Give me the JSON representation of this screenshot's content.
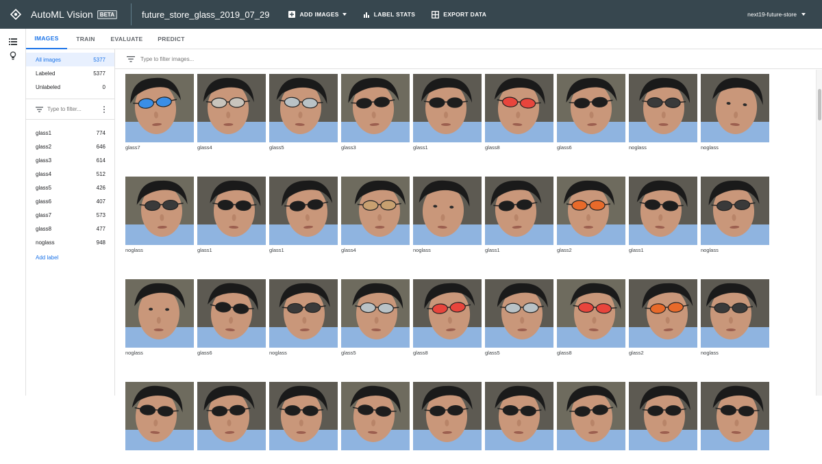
{
  "app": {
    "title": "AutoML Vision",
    "badge": "BETA"
  },
  "dataset": {
    "name": "future_store_glass_2019_07_29"
  },
  "toolbar": {
    "add_images": "ADD IMAGES",
    "label_stats": "LABEL STATS",
    "export_data": "EXPORT DATA"
  },
  "project": {
    "name": "next19-future-store"
  },
  "tabs": [
    {
      "label": "IMAGES",
      "active": true
    },
    {
      "label": "TRAIN",
      "active": false
    },
    {
      "label": "EVALUATE",
      "active": false
    },
    {
      "label": "PREDICT",
      "active": false
    }
  ],
  "summary": [
    {
      "label": "All images",
      "count": "5377",
      "active": true
    },
    {
      "label": "Labeled",
      "count": "5377",
      "active": false
    },
    {
      "label": "Unlabeled",
      "count": "0",
      "active": false
    }
  ],
  "label_filter": {
    "placeholder": "Type to filter..."
  },
  "labels": [
    {
      "label": "glass1",
      "count": "774"
    },
    {
      "label": "glass2",
      "count": "646"
    },
    {
      "label": "glass3",
      "count": "614"
    },
    {
      "label": "glass4",
      "count": "512"
    },
    {
      "label": "glass5",
      "count": "426"
    },
    {
      "label": "glass6",
      "count": "407"
    },
    {
      "label": "glass7",
      "count": "573"
    },
    {
      "label": "glass8",
      "count": "477"
    },
    {
      "label": "noglass",
      "count": "948"
    }
  ],
  "add_label": "Add label",
  "image_filter": {
    "placeholder": "Type to filter images..."
  },
  "images": [
    {
      "caption": "glass7",
      "glasses": "#3a8ee6"
    },
    {
      "caption": "glass4",
      "glasses": "#c8c4bc"
    },
    {
      "caption": "glass5",
      "glasses": "#b9c2c6"
    },
    {
      "caption": "glass3",
      "glasses": "#1d1d1d"
    },
    {
      "caption": "glass1",
      "glasses": "#1d1d1d"
    },
    {
      "caption": "glass8",
      "glasses": "#e8453c"
    },
    {
      "caption": "glass6",
      "glasses": "#1d1d1d"
    },
    {
      "caption": "noglass",
      "glasses": "#3a3a3a"
    },
    {
      "caption": "noglass",
      "glasses": ""
    },
    {
      "caption": "noglass",
      "glasses": "#3a3a3a"
    },
    {
      "caption": "glass1",
      "glasses": "#1d1d1d"
    },
    {
      "caption": "glass1",
      "glasses": "#1d1d1d"
    },
    {
      "caption": "glass4",
      "glasses": "#c8a070"
    },
    {
      "caption": "noglass",
      "glasses": ""
    },
    {
      "caption": "glass1",
      "glasses": "#1d1d1d"
    },
    {
      "caption": "glass2",
      "glasses": "#e86a2a"
    },
    {
      "caption": "glass1",
      "glasses": "#1d1d1d"
    },
    {
      "caption": "noglass",
      "glasses": "#3a3a3a"
    },
    {
      "caption": "noglass",
      "glasses": ""
    },
    {
      "caption": "glass6",
      "glasses": "#1d1d1d"
    },
    {
      "caption": "noglass",
      "glasses": "#3a3a3a"
    },
    {
      "caption": "glass5",
      "glasses": "#b9c2c6"
    },
    {
      "caption": "glass8",
      "glasses": "#e8453c"
    },
    {
      "caption": "glass5",
      "glasses": "#b9c2c6"
    },
    {
      "caption": "glass8",
      "glasses": "#e8453c"
    },
    {
      "caption": "glass2",
      "glasses": "#e86a2a"
    },
    {
      "caption": "noglass",
      "glasses": "#3a3a3a"
    }
  ],
  "colors": {
    "topbar": "#37474f",
    "accent": "#1a73e8",
    "skin": "#c9977a",
    "hair": "#1a1a1a",
    "shirt": "#8fb4e0"
  }
}
